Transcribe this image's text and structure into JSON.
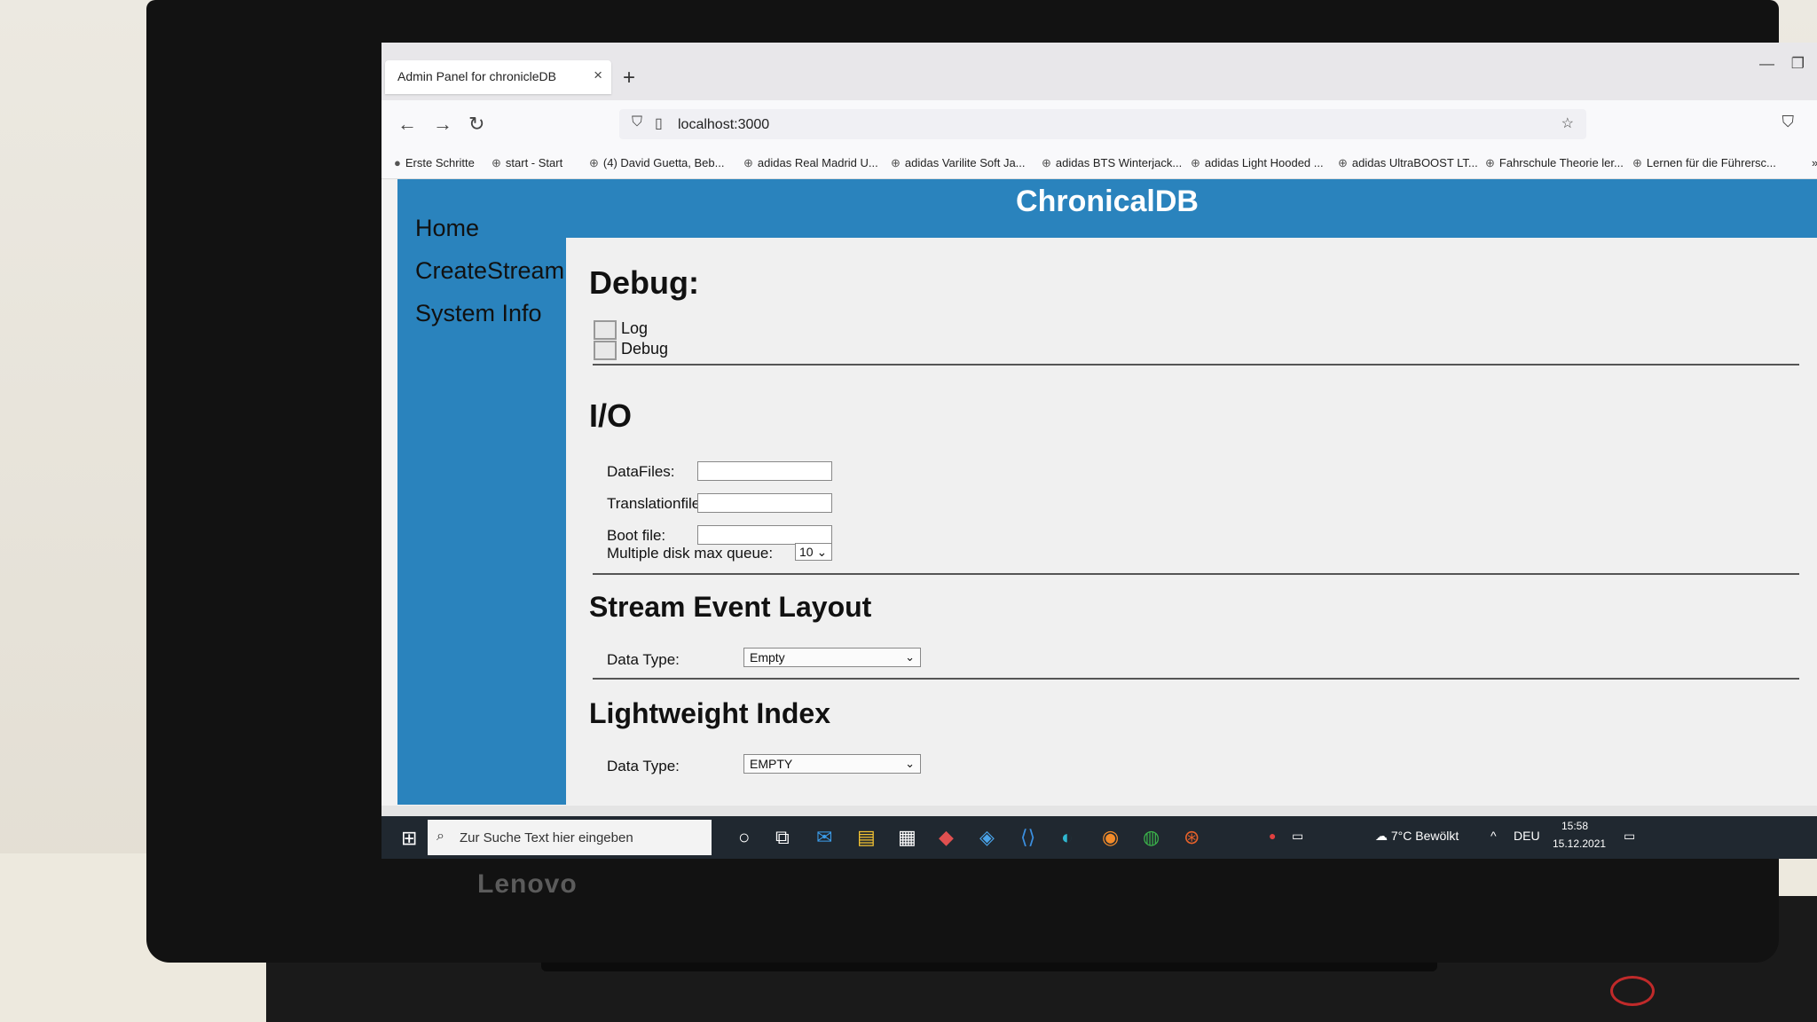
{
  "browser": {
    "tab_title": "Admin Panel for chronicleDB",
    "tab_close": "×",
    "new_tab": "+",
    "url": "localhost:3000"
  },
  "bookmarks": [
    "Erste Schritte",
    "start - Start",
    "(4) David Guetta, Beb...",
    "adidas Real Madrid U...",
    "adidas Varilite Soft Ja...",
    "adidas BTS Winterjack...",
    "adidas Light Hooded ...",
    "adidas UltraBOOST LT...",
    "Fahrschule Theorie ler...",
    "Lernen für die Führersc..."
  ],
  "app": {
    "title": "ChronicalDB",
    "nav": [
      "Home",
      "CreateStream",
      "System Info"
    ]
  },
  "debug": {
    "heading": "Debug:",
    "checkboxes": [
      "Log",
      "Debug"
    ]
  },
  "io": {
    "heading": "I/O",
    "fields": [
      "DataFiles:",
      "Translationfiles:",
      "Boot file:"
    ],
    "queue_label": "Multiple disk max queue:",
    "queue_value": "10"
  },
  "stream_event_layout": {
    "heading": "Stream Event Layout",
    "label": "Data Type:",
    "value": "Empty"
  },
  "lightweight_index": {
    "heading": "Lightweight Index",
    "label": "Data Type:",
    "value": "EMPTY"
  },
  "taskbar": {
    "search_placeholder": "Zur Suche Text hier eingeben",
    "weather": "7°C Bewölkt",
    "language": "DEU",
    "time": "15:58",
    "date": "15.12.2021"
  },
  "device": {
    "brand": "Lenovo"
  }
}
